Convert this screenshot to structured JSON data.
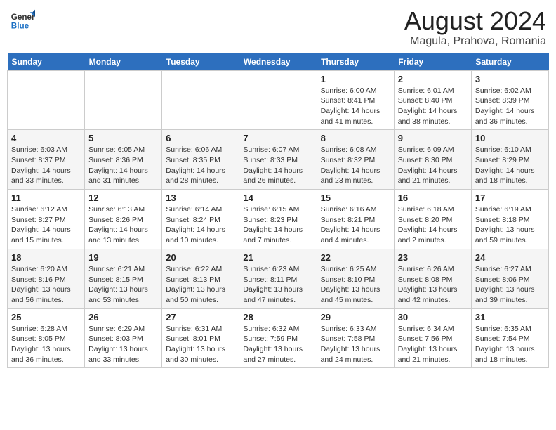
{
  "header": {
    "logo_line1": "General",
    "logo_line2": "Blue",
    "title": "August 2024",
    "subtitle": "Magula, Prahova, Romania"
  },
  "days_of_week": [
    "Sunday",
    "Monday",
    "Tuesday",
    "Wednesday",
    "Thursday",
    "Friday",
    "Saturday"
  ],
  "weeks": [
    [
      {
        "day": "",
        "info": ""
      },
      {
        "day": "",
        "info": ""
      },
      {
        "day": "",
        "info": ""
      },
      {
        "day": "",
        "info": ""
      },
      {
        "day": "1",
        "info": "Sunrise: 6:00 AM\nSunset: 8:41 PM\nDaylight: 14 hours\nand 41 minutes."
      },
      {
        "day": "2",
        "info": "Sunrise: 6:01 AM\nSunset: 8:40 PM\nDaylight: 14 hours\nand 38 minutes."
      },
      {
        "day": "3",
        "info": "Sunrise: 6:02 AM\nSunset: 8:39 PM\nDaylight: 14 hours\nand 36 minutes."
      }
    ],
    [
      {
        "day": "4",
        "info": "Sunrise: 6:03 AM\nSunset: 8:37 PM\nDaylight: 14 hours\nand 33 minutes."
      },
      {
        "day": "5",
        "info": "Sunrise: 6:05 AM\nSunset: 8:36 PM\nDaylight: 14 hours\nand 31 minutes."
      },
      {
        "day": "6",
        "info": "Sunrise: 6:06 AM\nSunset: 8:35 PM\nDaylight: 14 hours\nand 28 minutes."
      },
      {
        "day": "7",
        "info": "Sunrise: 6:07 AM\nSunset: 8:33 PM\nDaylight: 14 hours\nand 26 minutes."
      },
      {
        "day": "8",
        "info": "Sunrise: 6:08 AM\nSunset: 8:32 PM\nDaylight: 14 hours\nand 23 minutes."
      },
      {
        "day": "9",
        "info": "Sunrise: 6:09 AM\nSunset: 8:30 PM\nDaylight: 14 hours\nand 21 minutes."
      },
      {
        "day": "10",
        "info": "Sunrise: 6:10 AM\nSunset: 8:29 PM\nDaylight: 14 hours\nand 18 minutes."
      }
    ],
    [
      {
        "day": "11",
        "info": "Sunrise: 6:12 AM\nSunset: 8:27 PM\nDaylight: 14 hours\nand 15 minutes."
      },
      {
        "day": "12",
        "info": "Sunrise: 6:13 AM\nSunset: 8:26 PM\nDaylight: 14 hours\nand 13 minutes."
      },
      {
        "day": "13",
        "info": "Sunrise: 6:14 AM\nSunset: 8:24 PM\nDaylight: 14 hours\nand 10 minutes."
      },
      {
        "day": "14",
        "info": "Sunrise: 6:15 AM\nSunset: 8:23 PM\nDaylight: 14 hours\nand 7 minutes."
      },
      {
        "day": "15",
        "info": "Sunrise: 6:16 AM\nSunset: 8:21 PM\nDaylight: 14 hours\nand 4 minutes."
      },
      {
        "day": "16",
        "info": "Sunrise: 6:18 AM\nSunset: 8:20 PM\nDaylight: 14 hours\nand 2 minutes."
      },
      {
        "day": "17",
        "info": "Sunrise: 6:19 AM\nSunset: 8:18 PM\nDaylight: 13 hours\nand 59 minutes."
      }
    ],
    [
      {
        "day": "18",
        "info": "Sunrise: 6:20 AM\nSunset: 8:16 PM\nDaylight: 13 hours\nand 56 minutes."
      },
      {
        "day": "19",
        "info": "Sunrise: 6:21 AM\nSunset: 8:15 PM\nDaylight: 13 hours\nand 53 minutes."
      },
      {
        "day": "20",
        "info": "Sunrise: 6:22 AM\nSunset: 8:13 PM\nDaylight: 13 hours\nand 50 minutes."
      },
      {
        "day": "21",
        "info": "Sunrise: 6:23 AM\nSunset: 8:11 PM\nDaylight: 13 hours\nand 47 minutes."
      },
      {
        "day": "22",
        "info": "Sunrise: 6:25 AM\nSunset: 8:10 PM\nDaylight: 13 hours\nand 45 minutes."
      },
      {
        "day": "23",
        "info": "Sunrise: 6:26 AM\nSunset: 8:08 PM\nDaylight: 13 hours\nand 42 minutes."
      },
      {
        "day": "24",
        "info": "Sunrise: 6:27 AM\nSunset: 8:06 PM\nDaylight: 13 hours\nand 39 minutes."
      }
    ],
    [
      {
        "day": "25",
        "info": "Sunrise: 6:28 AM\nSunset: 8:05 PM\nDaylight: 13 hours\nand 36 minutes."
      },
      {
        "day": "26",
        "info": "Sunrise: 6:29 AM\nSunset: 8:03 PM\nDaylight: 13 hours\nand 33 minutes."
      },
      {
        "day": "27",
        "info": "Sunrise: 6:31 AM\nSunset: 8:01 PM\nDaylight: 13 hours\nand 30 minutes."
      },
      {
        "day": "28",
        "info": "Sunrise: 6:32 AM\nSunset: 7:59 PM\nDaylight: 13 hours\nand 27 minutes."
      },
      {
        "day": "29",
        "info": "Sunrise: 6:33 AM\nSunset: 7:58 PM\nDaylight: 13 hours\nand 24 minutes."
      },
      {
        "day": "30",
        "info": "Sunrise: 6:34 AM\nSunset: 7:56 PM\nDaylight: 13 hours\nand 21 minutes."
      },
      {
        "day": "31",
        "info": "Sunrise: 6:35 AM\nSunset: 7:54 PM\nDaylight: 13 hours\nand 18 minutes."
      }
    ]
  ]
}
